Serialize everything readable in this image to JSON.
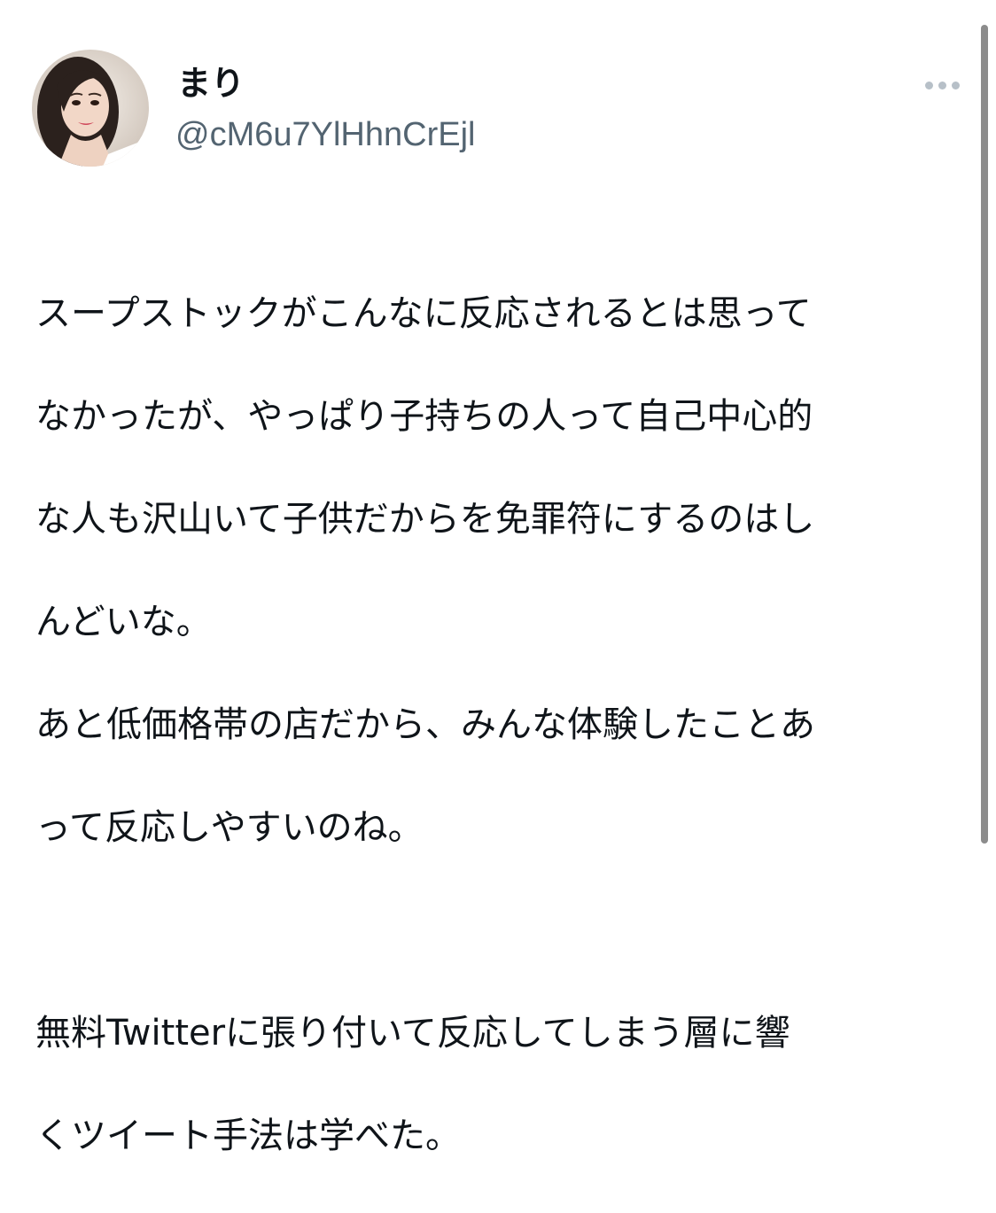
{
  "user": {
    "display_name": "まり",
    "username": "@cM6u7YlHhnCrEjl",
    "avatar_icon": "profile-photo"
  },
  "menu": {
    "more_icon": "more-horizontal-icon"
  },
  "tweet": {
    "lines": [
      "スープストックがこんなに反応されるとは思って",
      "なかったが、やっぱり子持ちの人って自己中心的",
      "な人も沢山いて子供だからを免罪符にするのはし",
      "んどいな。",
      "あと低価格帯の店だから、みんな体験したことあ",
      "って反応しやすいのね。",
      "",
      "無料Twitterに張り付いて反応してしまう層に響",
      "くツイート手法は学べた。"
    ]
  },
  "colors": {
    "text": "#0f1419",
    "secondary": "#536471",
    "menu_dots": "#b7c0c8",
    "scrollbar": "#8c8c8c"
  }
}
